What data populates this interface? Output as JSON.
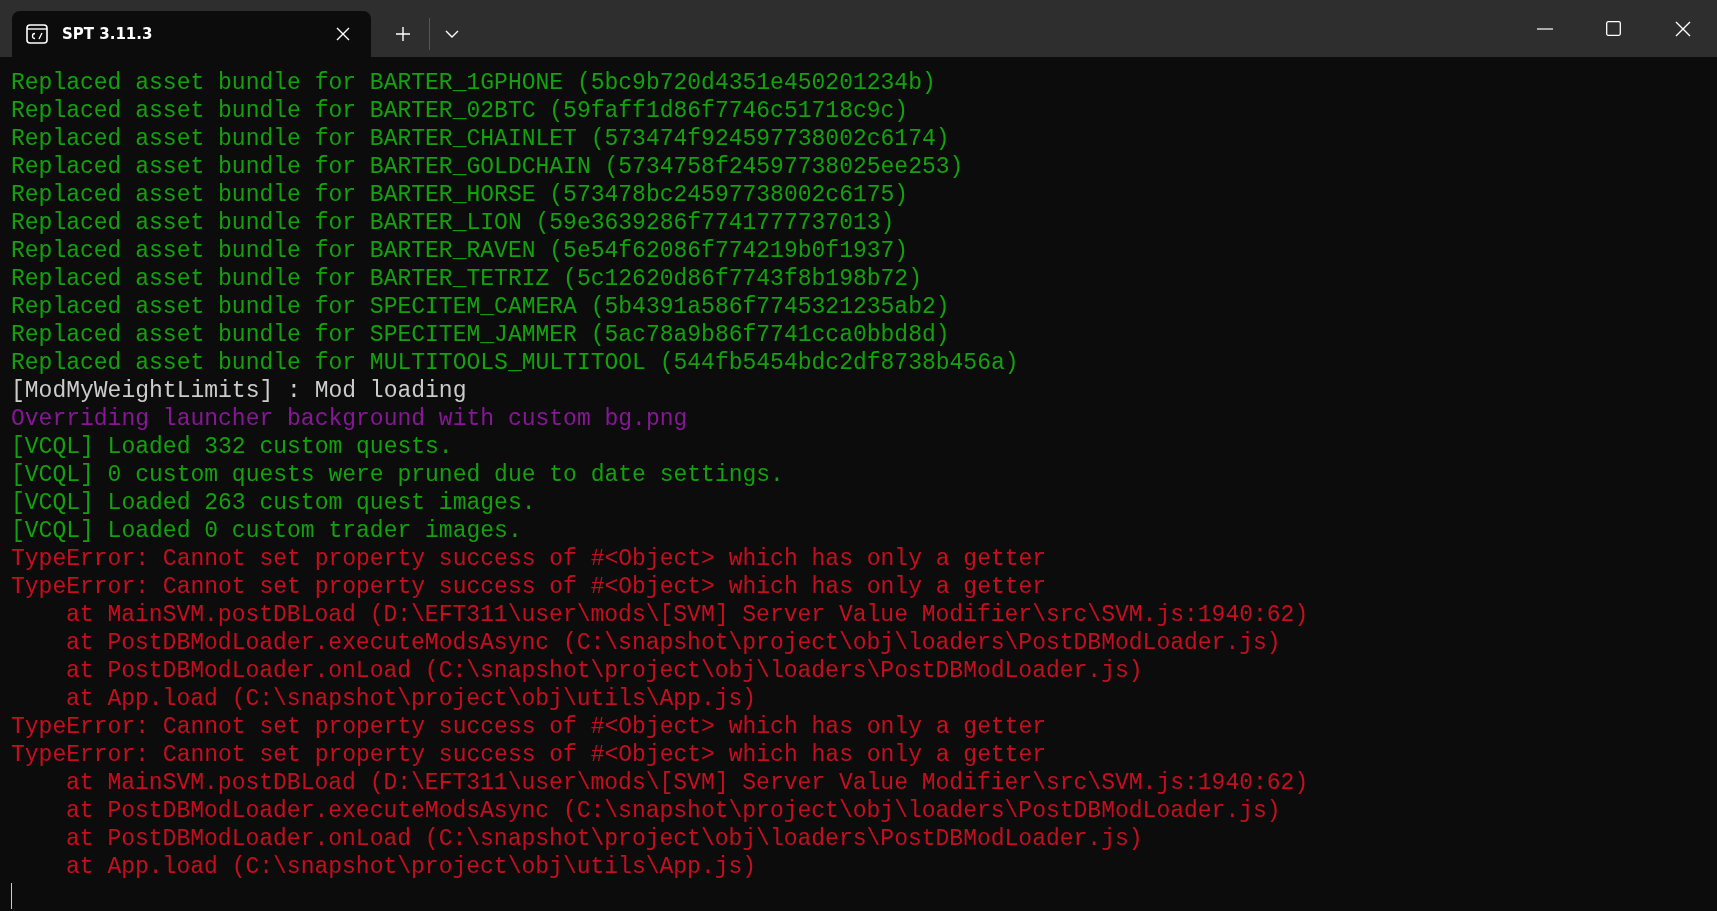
{
  "tab": {
    "title": "SPT 3.11.3",
    "selected": true
  },
  "lines": [
    {
      "kind": "success",
      "text": "Replaced asset bundle for BARTER_1GPHONE (5bc9b720d4351e450201234b)"
    },
    {
      "kind": "success",
      "text": "Replaced asset bundle for BARTER_02BTC (59faff1d86f7746c51718c9c)"
    },
    {
      "kind": "success",
      "text": "Replaced asset bundle for BARTER_CHAINLET (573474f924597738002c6174)"
    },
    {
      "kind": "success",
      "text": "Replaced asset bundle for BARTER_GOLDCHAIN (5734758f24597738025ee253)"
    },
    {
      "kind": "success",
      "text": "Replaced asset bundle for BARTER_HORSE (573478bc24597738002c6175)"
    },
    {
      "kind": "success",
      "text": "Replaced asset bundle for BARTER_LION (59e3639286f7741777737013)"
    },
    {
      "kind": "success",
      "text": "Replaced asset bundle for BARTER_RAVEN (5e54f62086f774219b0f1937)"
    },
    {
      "kind": "success",
      "text": "Replaced asset bundle for BARTER_TETRIZ (5c12620d86f7743f8b198b72)"
    },
    {
      "kind": "success",
      "text": "Replaced asset bundle for SPECITEM_CAMERA (5b4391a586f7745321235ab2)"
    },
    {
      "kind": "success",
      "text": "Replaced asset bundle for SPECITEM_JAMMER (5ac78a9b86f7741cca0bbd8d)"
    },
    {
      "kind": "success",
      "text": "Replaced asset bundle for MULTITOOLS_MULTITOOL (544fb5454bdc2df8738b456a)"
    },
    {
      "kind": "info",
      "text": "[ModMyWeightLimits] : Mod loading"
    },
    {
      "kind": "notice",
      "text": "Overriding launcher background with custom bg.png"
    },
    {
      "kind": "success",
      "text": "[VCQL] Loaded 332 custom quests."
    },
    {
      "kind": "success",
      "text": "[VCQL] 0 custom quests were pruned due to date settings."
    },
    {
      "kind": "success",
      "text": "[VCQL] Loaded 263 custom quest images."
    },
    {
      "kind": "success",
      "text": "[VCQL] Loaded 0 custom trader images."
    },
    {
      "kind": "error",
      "text": "TypeError: Cannot set property success of #<Object> which has only a getter"
    },
    {
      "kind": "error",
      "text": "TypeError: Cannot set property success of #<Object> which has only a getter"
    },
    {
      "kind": "stack",
      "text": "at MainSVM.postDBLoad (D:\\EFT311\\user\\mods\\[SVM] Server Value Modifier\\src\\SVM.js:1940:62)"
    },
    {
      "kind": "stack",
      "text": "at PostDBModLoader.executeModsAsync (C:\\snapshot\\project\\obj\\loaders\\PostDBModLoader.js)"
    },
    {
      "kind": "stack",
      "text": "at PostDBModLoader.onLoad (C:\\snapshot\\project\\obj\\loaders\\PostDBModLoader.js)"
    },
    {
      "kind": "stack",
      "text": "at App.load (C:\\snapshot\\project\\obj\\utils\\App.js)"
    },
    {
      "kind": "error",
      "text": "TypeError: Cannot set property success of #<Object> which has only a getter"
    },
    {
      "kind": "error",
      "text": "TypeError: Cannot set property success of #<Object> which has only a getter"
    },
    {
      "kind": "stack",
      "text": "at MainSVM.postDBLoad (D:\\EFT311\\user\\mods\\[SVM] Server Value Modifier\\src\\SVM.js:1940:62)"
    },
    {
      "kind": "stack",
      "text": "at PostDBModLoader.executeModsAsync (C:\\snapshot\\project\\obj\\loaders\\PostDBModLoader.js)"
    },
    {
      "kind": "stack",
      "text": "at PostDBModLoader.onLoad (C:\\snapshot\\project\\obj\\loaders\\PostDBModLoader.js)"
    },
    {
      "kind": "stack",
      "text": "at App.load (C:\\snapshot\\project\\obj\\utils\\App.js)"
    }
  ]
}
